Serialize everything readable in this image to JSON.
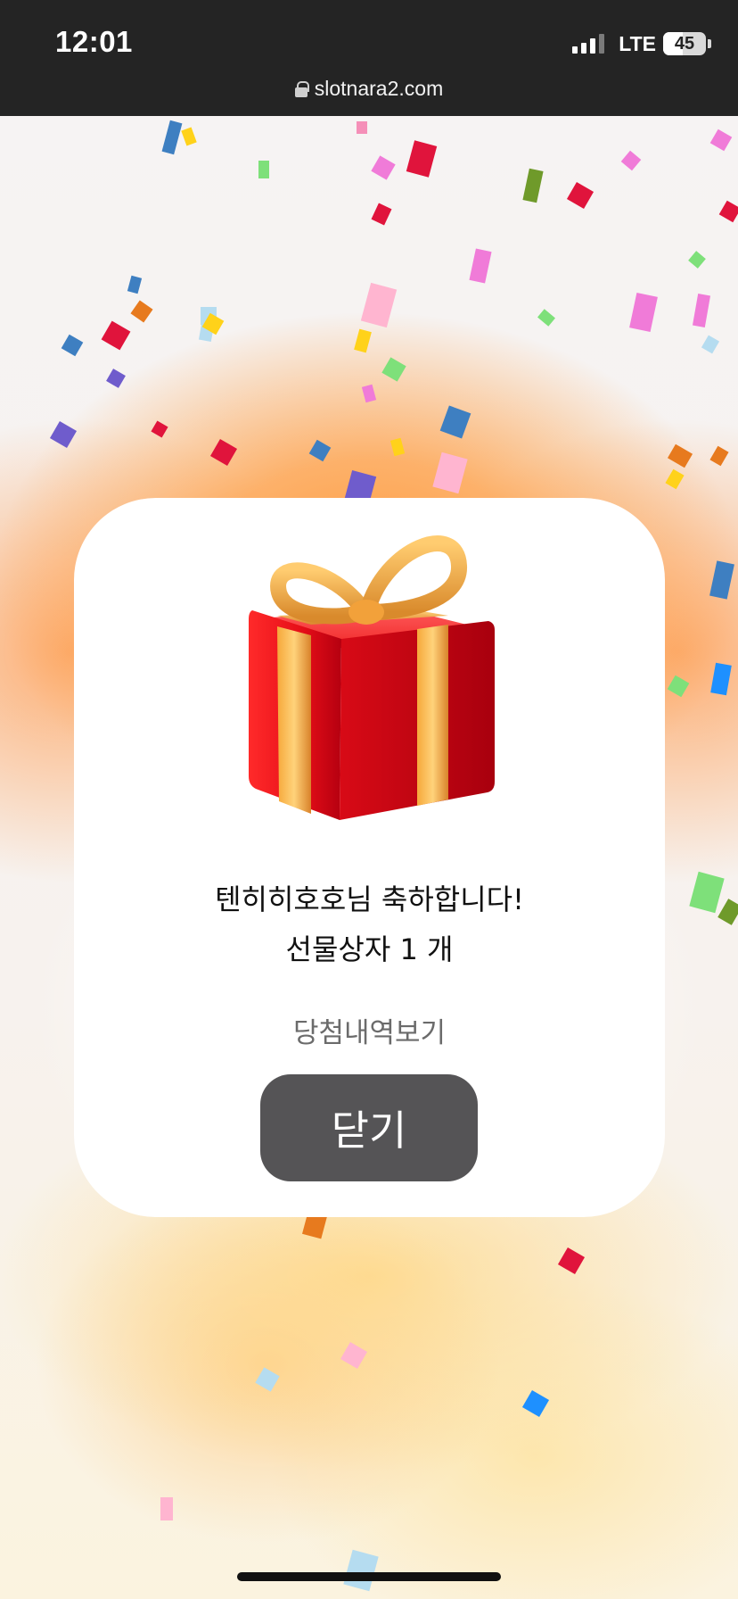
{
  "status_bar": {
    "time": "12:01",
    "network": "LTE",
    "battery": "45",
    "battery_level": 0.45
  },
  "browser": {
    "url": "slotnara2.com"
  },
  "modal": {
    "gift_icon": "gift-box-icon",
    "message_line1": "텐히히호호님 축하합니다!",
    "message_line2": "선물상자 1 개",
    "history_link": "당첨내역보기",
    "close_label": "닫기"
  },
  "colors": {
    "status_bar_bg": "#242424",
    "close_button_bg": "#555456",
    "card_bg": "#ffffff",
    "glow_orange": "#ff9b3d"
  }
}
